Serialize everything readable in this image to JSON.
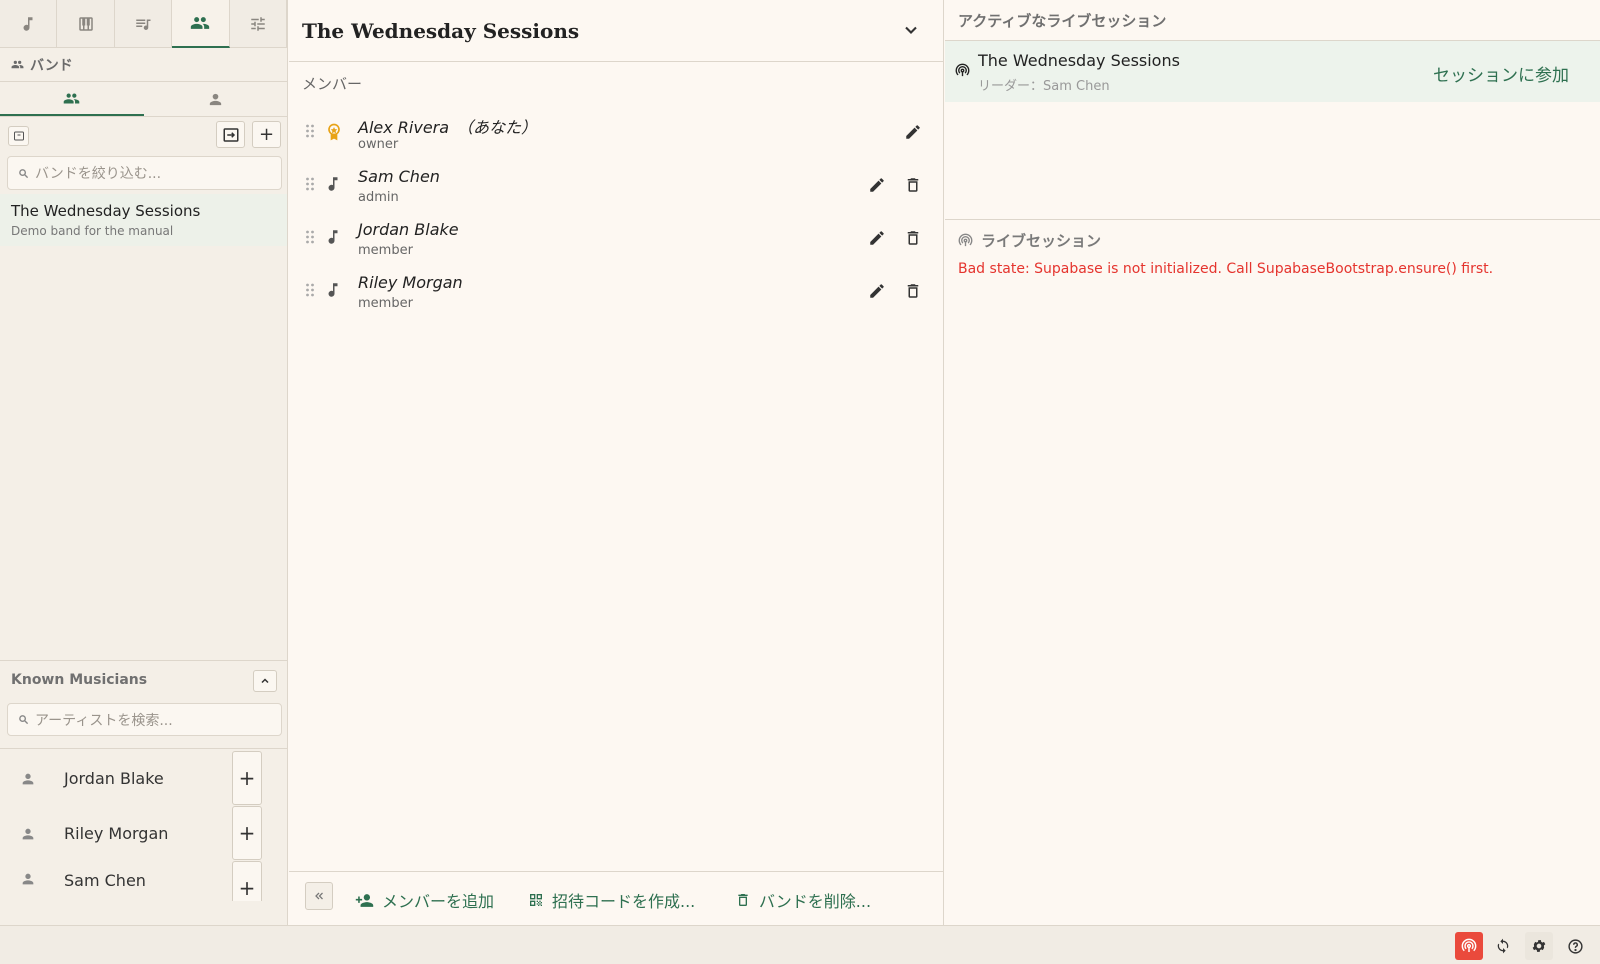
{
  "sidebar": {
    "section_title": "バンド",
    "band_filter_placeholder": "バンドを絞り込む...",
    "band": {
      "name": "The Wednesday Sessions",
      "description": "Demo band for the manual"
    },
    "known_title": "Known Musicians",
    "artist_search_placeholder": "アーティストを検索...",
    "musicians": [
      {
        "name": "Jordan Blake"
      },
      {
        "name": "Riley Morgan"
      },
      {
        "name": "Sam Chen"
      }
    ]
  },
  "main": {
    "title": "The Wednesday Sessions",
    "members_label": "メンバー",
    "members": [
      {
        "name": "Alex Rivera　（あなた）",
        "role": "owner"
      },
      {
        "name": "Sam Chen",
        "role": "admin"
      },
      {
        "name": "Jordan Blake",
        "role": "member"
      },
      {
        "name": "Riley Morgan",
        "role": "member"
      }
    ],
    "footer": {
      "add_member": "メンバーを追加",
      "invite_code": "招待コードを作成...",
      "delete_band": "バンドを削除..."
    }
  },
  "right": {
    "active_title": "アクティブなライブセッション",
    "session": {
      "name": "The Wednesday Sessions",
      "leader": "リーダー：Sam Chen",
      "join": "セッションに参加"
    },
    "live_title": "ライブセッション",
    "error": "Bad state: Supabase is not initialized. Call SupabaseBootstrap.ensure() first."
  },
  "colors": {
    "accent": "#2e7050",
    "error": "#e5342e",
    "owner_badge": "#e8a317",
    "live_button": "#ea4a3c"
  }
}
